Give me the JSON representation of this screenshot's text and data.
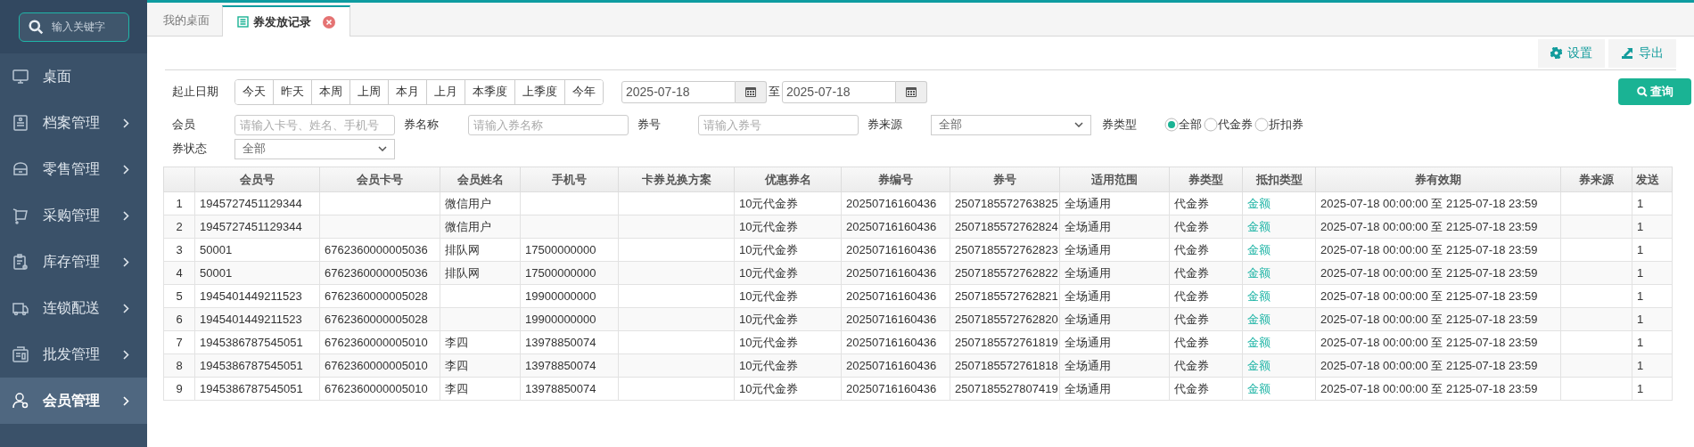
{
  "sidebar": {
    "search": {
      "placeholder": "输入关键字"
    },
    "items": [
      {
        "label": "桌面",
        "has_submenu": false,
        "selected": false
      },
      {
        "label": "档案管理",
        "has_submenu": true,
        "selected": false
      },
      {
        "label": "零售管理",
        "has_submenu": true,
        "selected": false
      },
      {
        "label": "采购管理",
        "has_submenu": true,
        "selected": false
      },
      {
        "label": "库存管理",
        "has_submenu": true,
        "selected": false
      },
      {
        "label": "连锁配送",
        "has_submenu": true,
        "selected": false
      },
      {
        "label": "批发管理",
        "has_submenu": true,
        "selected": false
      },
      {
        "label": "会员管理",
        "has_submenu": true,
        "selected": true
      }
    ]
  },
  "tabs": [
    {
      "label": "我的桌面",
      "selected": false,
      "closable": false
    },
    {
      "label": "券发放记录",
      "selected": true,
      "closable": true
    }
  ],
  "toolbar": [
    "设置",
    "导出"
  ],
  "filters": {
    "date_label": "起止日期",
    "quick_ranges": [
      "今天",
      "昨天",
      "本周",
      "上周",
      "本月",
      "上月",
      "本季度",
      "上季度",
      "今年"
    ],
    "date_from": "2025-07-18",
    "date_sep": "至",
    "date_to": "2025-07-18",
    "query_button": "查询",
    "fields": [
      {
        "label": "会员",
        "kind": "input",
        "placeholder": "请输入卡号、姓名、手机号"
      },
      {
        "label": "券名称",
        "kind": "input",
        "placeholder": "请输入券名称"
      },
      {
        "label": "券号",
        "kind": "input",
        "placeholder": "请输入券号"
      },
      {
        "label": "券来源",
        "kind": "select",
        "value": "全部"
      }
    ],
    "type_label": "券类型",
    "type_options": [
      {
        "label": "全部",
        "selected": true
      },
      {
        "label": "代金券",
        "selected": false
      },
      {
        "label": "折扣券",
        "selected": false
      }
    ],
    "status_label": "券状态",
    "status_value": "全部"
  },
  "table": {
    "columns": [
      "",
      "会员号",
      "会员卡号",
      "会员姓名",
      "手机号",
      "卡券兑换方案",
      "优惠券名",
      "券编号",
      "券号",
      "适用范围",
      "券类型",
      "抵扣类型",
      "券有效期",
      "券来源",
      "发送"
    ],
    "rows": [
      [
        "1",
        "1945727451129344",
        "",
        "微信用户",
        "",
        "",
        "10元代金券",
        "20250716160436",
        "2507185572763825",
        "全场通用",
        "代金券",
        "金额",
        "2025-07-18 00:00:00  至  2125-07-18 23:59",
        "",
        "1"
      ],
      [
        "2",
        "1945727451129344",
        "",
        "微信用户",
        "",
        "",
        "10元代金券",
        "20250716160436",
        "2507185572762824",
        "全场通用",
        "代金券",
        "金额",
        "2025-07-18 00:00:00  至  2125-07-18 23:59",
        "",
        "1"
      ],
      [
        "3",
        "50001",
        "6762360000005036",
        "排队网",
        "17500000000",
        "",
        "10元代金券",
        "20250716160436",
        "2507185572762823",
        "全场通用",
        "代金券",
        "金额",
        "2025-07-18 00:00:00  至  2125-07-18 23:59",
        "",
        "1"
      ],
      [
        "4",
        "50001",
        "6762360000005036",
        "排队网",
        "17500000000",
        "",
        "10元代金券",
        "20250716160436",
        "2507185572762822",
        "全场通用",
        "代金券",
        "金额",
        "2025-07-18 00:00:00  至  2125-07-18 23:59",
        "",
        "1"
      ],
      [
        "5",
        "1945401449211523",
        "6762360000005028",
        "",
        "19900000000",
        "",
        "10元代金券",
        "20250716160436",
        "2507185572762821",
        "全场通用",
        "代金券",
        "金额",
        "2025-07-18 00:00:00  至  2125-07-18 23:59",
        "",
        "1"
      ],
      [
        "6",
        "1945401449211523",
        "6762360000005028",
        "",
        "19900000000",
        "",
        "10元代金券",
        "20250716160436",
        "2507185572762820",
        "全场通用",
        "代金券",
        "金额",
        "2025-07-18 00:00:00  至  2125-07-18 23:59",
        "",
        "1"
      ],
      [
        "7",
        "1945386787545051",
        "6762360000005010",
        "李四",
        "13978850074",
        "",
        "10元代金券",
        "20250716160436",
        "2507185572761819",
        "全场通用",
        "代金券",
        "金额",
        "2025-07-18 00:00:00  至  2125-07-18 23:59",
        "",
        "1"
      ],
      [
        "8",
        "1945386787545051",
        "6762360000005010",
        "李四",
        "13978850074",
        "",
        "10元代金券",
        "20250716160436",
        "2507185572761818",
        "全场通用",
        "代金券",
        "金额",
        "2025-07-18 00:00:00  至  2125-07-18 23:59",
        "",
        "1"
      ],
      [
        "9",
        "1945386787545051",
        "6762360000005010",
        "李四",
        "13978850074",
        "",
        "10元代金券",
        "20250716160436",
        "2507185527807419",
        "全场通用",
        "代金券",
        "金额",
        "2025-07-18 00:00:00  至  2125-07-18 23:59",
        "",
        "1"
      ]
    ]
  }
}
